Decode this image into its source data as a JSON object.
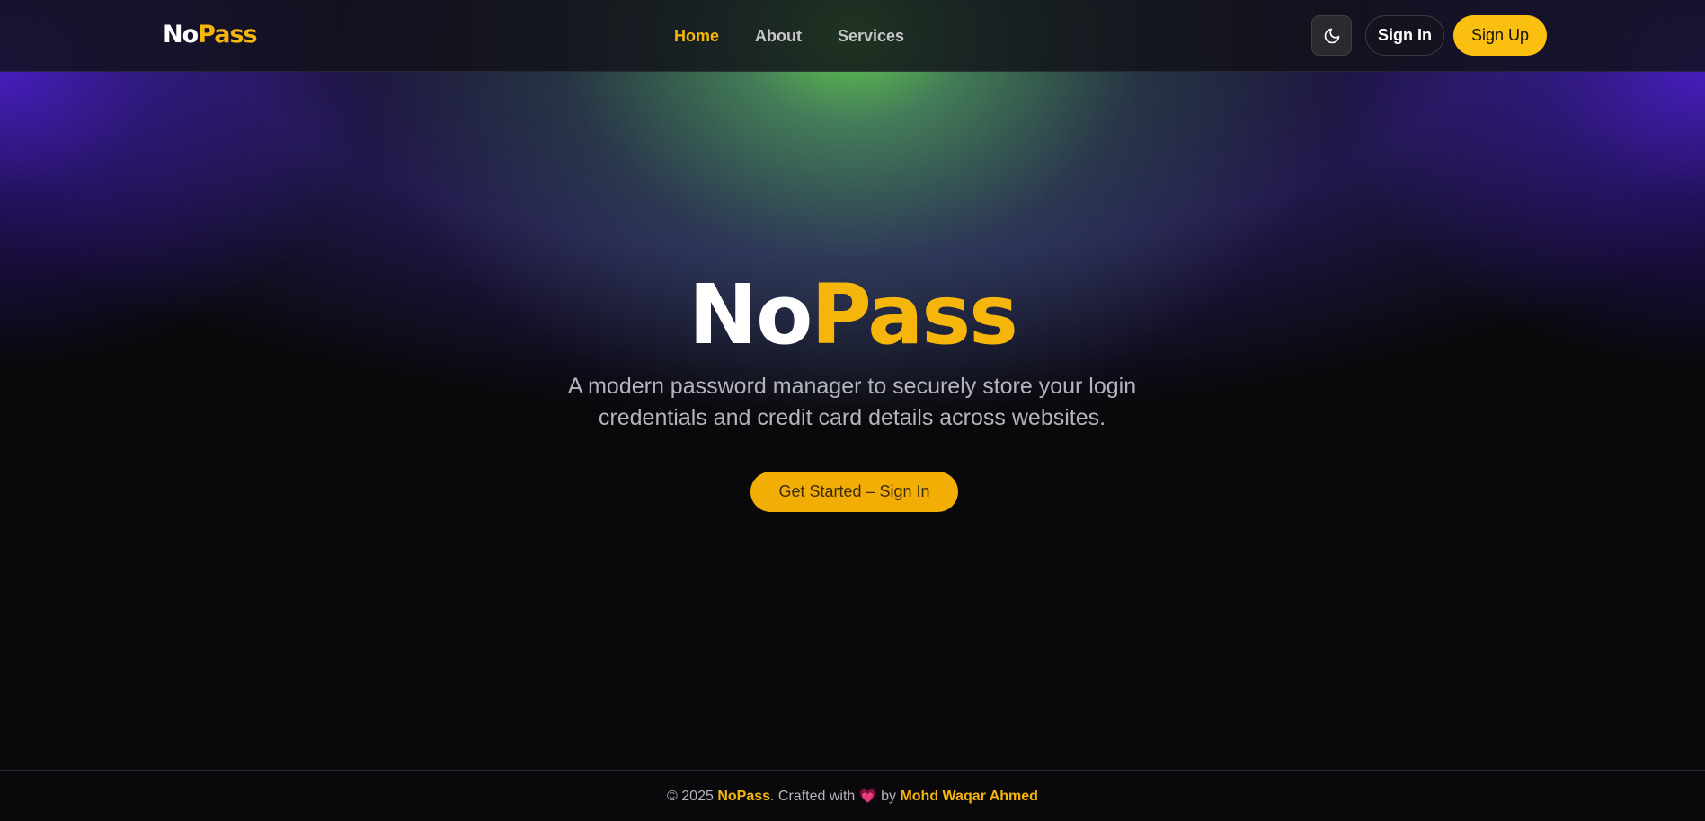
{
  "header": {
    "logo_no": "No",
    "logo_pass": "Pass",
    "nav": [
      {
        "label": "Home",
        "active": true
      },
      {
        "label": "About",
        "active": false
      },
      {
        "label": "Services",
        "active": false
      }
    ],
    "theme_toggle_icon": "moon-icon",
    "signin_label": "Sign In",
    "signup_label": "Sign Up"
  },
  "hero": {
    "title_no": "No",
    "title_pass": "Pass",
    "subtitle": "A modern password manager to securely store your login credentials and credit card details across websites.",
    "cta_label": "Get Started – Sign In"
  },
  "footer": {
    "copyright": "© 2025 ",
    "brand": "NoPass",
    "crafted": ". Crafted with ",
    "heart": "💗",
    "by": " by ",
    "author": "Mohd Waqar Ahmed"
  },
  "colors": {
    "accent": "#f5b50b",
    "background": "#09090b",
    "glow_green": "#68d852",
    "glow_violet": "#481cc8"
  }
}
